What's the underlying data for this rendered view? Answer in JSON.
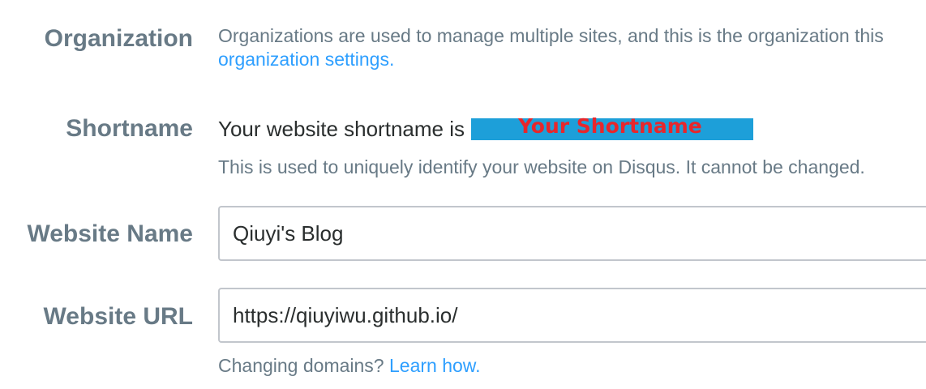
{
  "organization": {
    "label": "Organization",
    "description": "Organizations are used to manage multiple sites, and this is the organization this",
    "settings_link": "organization settings."
  },
  "shortname": {
    "label": "Shortname",
    "prefix": "Your website shortname is",
    "value": "Your Shortname",
    "note": "This is used to uniquely identify your website on Disqus. It cannot be changed."
  },
  "website_name": {
    "label": "Website Name",
    "value": "Qiuyi's Blog"
  },
  "website_url": {
    "label": "Website URL",
    "value": "https://qiuyiwu.github.io/",
    "domains_question": "Changing domains?",
    "learn_link": "Learn how."
  }
}
